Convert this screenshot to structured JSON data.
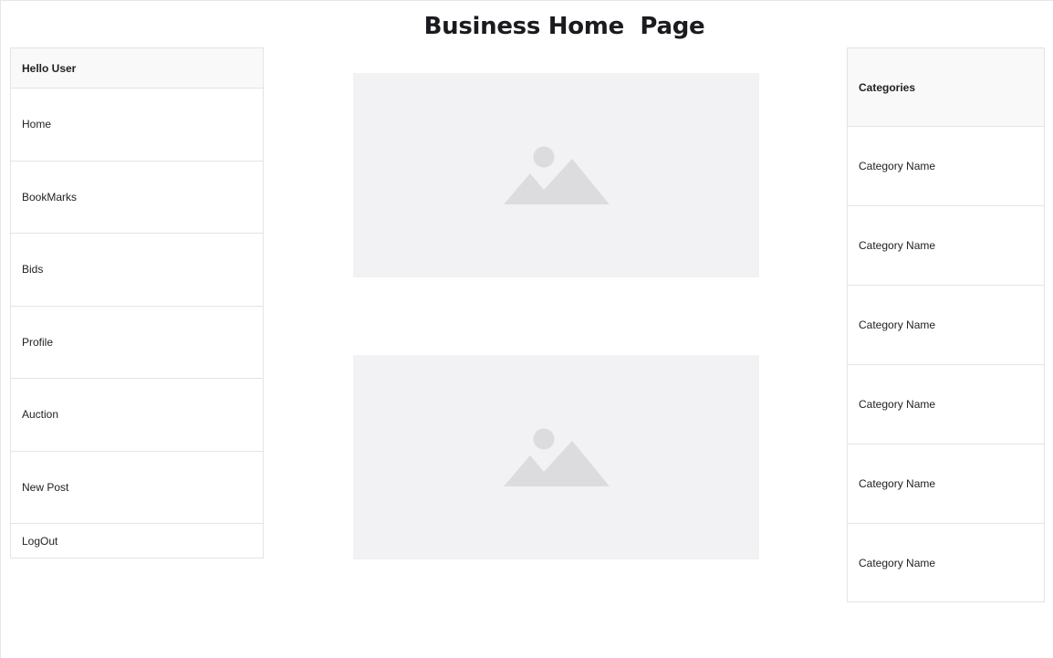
{
  "header": {
    "title": "Business Home  Page"
  },
  "sidebar": {
    "greeting": "Hello User",
    "items": [
      {
        "label": "Home"
      },
      {
        "label": "BookMarks"
      },
      {
        "label": "Bids"
      },
      {
        "label": "Profile"
      },
      {
        "label": "Auction"
      },
      {
        "label": "New Post"
      },
      {
        "label": "LogOut"
      }
    ]
  },
  "main": {
    "images": [
      {
        "icon": "image-placeholder-icon"
      },
      {
        "icon": "image-placeholder-icon"
      }
    ]
  },
  "categories": {
    "title": "Categories",
    "items": [
      {
        "label": "Category Name"
      },
      {
        "label": "Category Name"
      },
      {
        "label": "Category Name"
      },
      {
        "label": "Category Name"
      },
      {
        "label": "Category Name"
      },
      {
        "label": "Category Name"
      }
    ]
  },
  "colors": {
    "placeholder_bg": "#f2f2f4",
    "placeholder_icon": "#dcdcdf",
    "header_bg": "#f9f9f9",
    "border": "#e4e4e4"
  }
}
